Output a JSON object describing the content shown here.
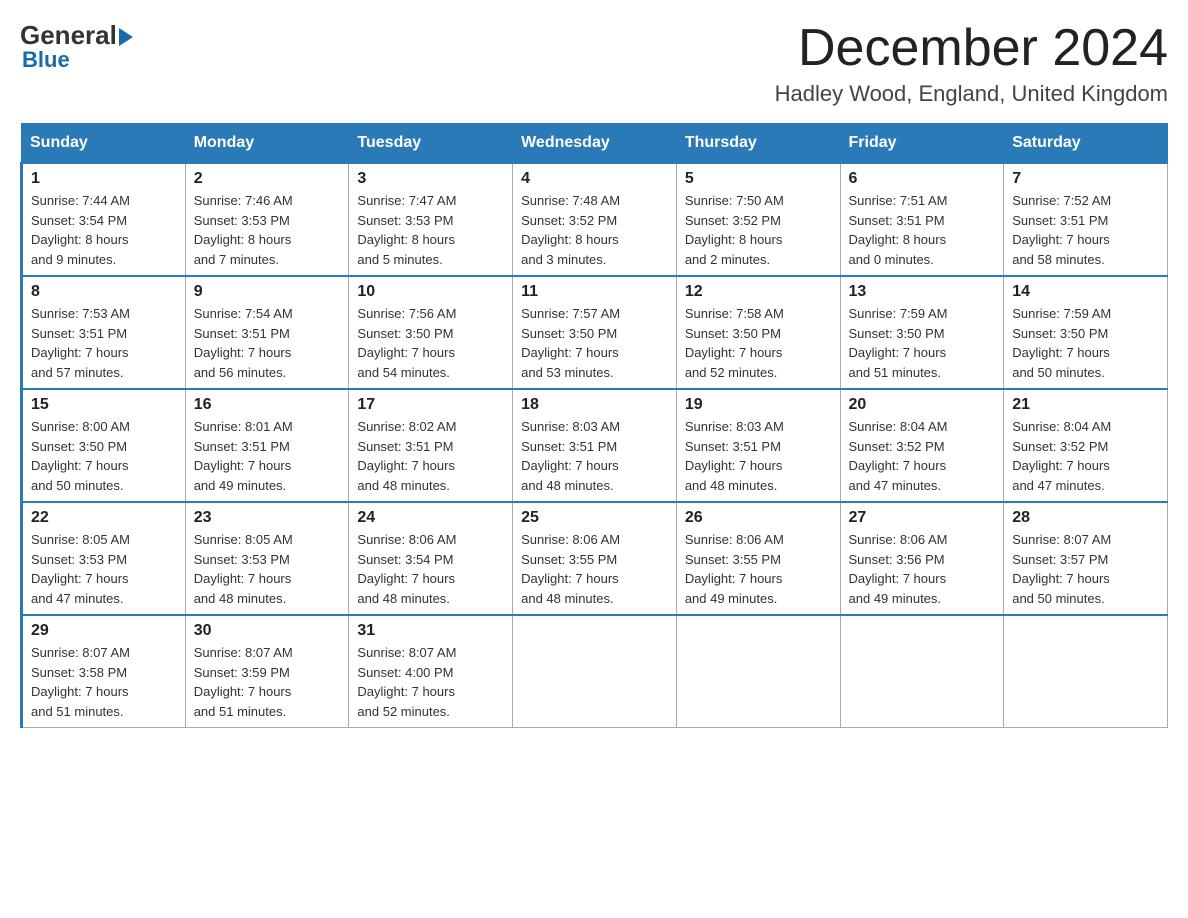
{
  "header": {
    "logo_general": "General",
    "logo_blue": "Blue",
    "title": "December 2024",
    "subtitle": "Hadley Wood, England, United Kingdom"
  },
  "days_of_week": [
    "Sunday",
    "Monday",
    "Tuesday",
    "Wednesday",
    "Thursday",
    "Friday",
    "Saturday"
  ],
  "weeks": [
    [
      {
        "day": "1",
        "sunrise": "7:44 AM",
        "sunset": "3:54 PM",
        "daylight": "8 hours and 9 minutes."
      },
      {
        "day": "2",
        "sunrise": "7:46 AM",
        "sunset": "3:53 PM",
        "daylight": "8 hours and 7 minutes."
      },
      {
        "day": "3",
        "sunrise": "7:47 AM",
        "sunset": "3:53 PM",
        "daylight": "8 hours and 5 minutes."
      },
      {
        "day": "4",
        "sunrise": "7:48 AM",
        "sunset": "3:52 PM",
        "daylight": "8 hours and 3 minutes."
      },
      {
        "day": "5",
        "sunrise": "7:50 AM",
        "sunset": "3:52 PM",
        "daylight": "8 hours and 2 minutes."
      },
      {
        "day": "6",
        "sunrise": "7:51 AM",
        "sunset": "3:51 PM",
        "daylight": "8 hours and 0 minutes."
      },
      {
        "day": "7",
        "sunrise": "7:52 AM",
        "sunset": "3:51 PM",
        "daylight": "7 hours and 58 minutes."
      }
    ],
    [
      {
        "day": "8",
        "sunrise": "7:53 AM",
        "sunset": "3:51 PM",
        "daylight": "7 hours and 57 minutes."
      },
      {
        "day": "9",
        "sunrise": "7:54 AM",
        "sunset": "3:51 PM",
        "daylight": "7 hours and 56 minutes."
      },
      {
        "day": "10",
        "sunrise": "7:56 AM",
        "sunset": "3:50 PM",
        "daylight": "7 hours and 54 minutes."
      },
      {
        "day": "11",
        "sunrise": "7:57 AM",
        "sunset": "3:50 PM",
        "daylight": "7 hours and 53 minutes."
      },
      {
        "day": "12",
        "sunrise": "7:58 AM",
        "sunset": "3:50 PM",
        "daylight": "7 hours and 52 minutes."
      },
      {
        "day": "13",
        "sunrise": "7:59 AM",
        "sunset": "3:50 PM",
        "daylight": "7 hours and 51 minutes."
      },
      {
        "day": "14",
        "sunrise": "7:59 AM",
        "sunset": "3:50 PM",
        "daylight": "7 hours and 50 minutes."
      }
    ],
    [
      {
        "day": "15",
        "sunrise": "8:00 AM",
        "sunset": "3:50 PM",
        "daylight": "7 hours and 50 minutes."
      },
      {
        "day": "16",
        "sunrise": "8:01 AM",
        "sunset": "3:51 PM",
        "daylight": "7 hours and 49 minutes."
      },
      {
        "day": "17",
        "sunrise": "8:02 AM",
        "sunset": "3:51 PM",
        "daylight": "7 hours and 48 minutes."
      },
      {
        "day": "18",
        "sunrise": "8:03 AM",
        "sunset": "3:51 PM",
        "daylight": "7 hours and 48 minutes."
      },
      {
        "day": "19",
        "sunrise": "8:03 AM",
        "sunset": "3:51 PM",
        "daylight": "7 hours and 48 minutes."
      },
      {
        "day": "20",
        "sunrise": "8:04 AM",
        "sunset": "3:52 PM",
        "daylight": "7 hours and 47 minutes."
      },
      {
        "day": "21",
        "sunrise": "8:04 AM",
        "sunset": "3:52 PM",
        "daylight": "7 hours and 47 minutes."
      }
    ],
    [
      {
        "day": "22",
        "sunrise": "8:05 AM",
        "sunset": "3:53 PM",
        "daylight": "7 hours and 47 minutes."
      },
      {
        "day": "23",
        "sunrise": "8:05 AM",
        "sunset": "3:53 PM",
        "daylight": "7 hours and 48 minutes."
      },
      {
        "day": "24",
        "sunrise": "8:06 AM",
        "sunset": "3:54 PM",
        "daylight": "7 hours and 48 minutes."
      },
      {
        "day": "25",
        "sunrise": "8:06 AM",
        "sunset": "3:55 PM",
        "daylight": "7 hours and 48 minutes."
      },
      {
        "day": "26",
        "sunrise": "8:06 AM",
        "sunset": "3:55 PM",
        "daylight": "7 hours and 49 minutes."
      },
      {
        "day": "27",
        "sunrise": "8:06 AM",
        "sunset": "3:56 PM",
        "daylight": "7 hours and 49 minutes."
      },
      {
        "day": "28",
        "sunrise": "8:07 AM",
        "sunset": "3:57 PM",
        "daylight": "7 hours and 50 minutes."
      }
    ],
    [
      {
        "day": "29",
        "sunrise": "8:07 AM",
        "sunset": "3:58 PM",
        "daylight": "7 hours and 51 minutes."
      },
      {
        "day": "30",
        "sunrise": "8:07 AM",
        "sunset": "3:59 PM",
        "daylight": "7 hours and 51 minutes."
      },
      {
        "day": "31",
        "sunrise": "8:07 AM",
        "sunset": "4:00 PM",
        "daylight": "7 hours and 52 minutes."
      },
      null,
      null,
      null,
      null
    ]
  ],
  "labels": {
    "sunrise": "Sunrise:",
    "sunset": "Sunset:",
    "daylight": "Daylight:"
  }
}
